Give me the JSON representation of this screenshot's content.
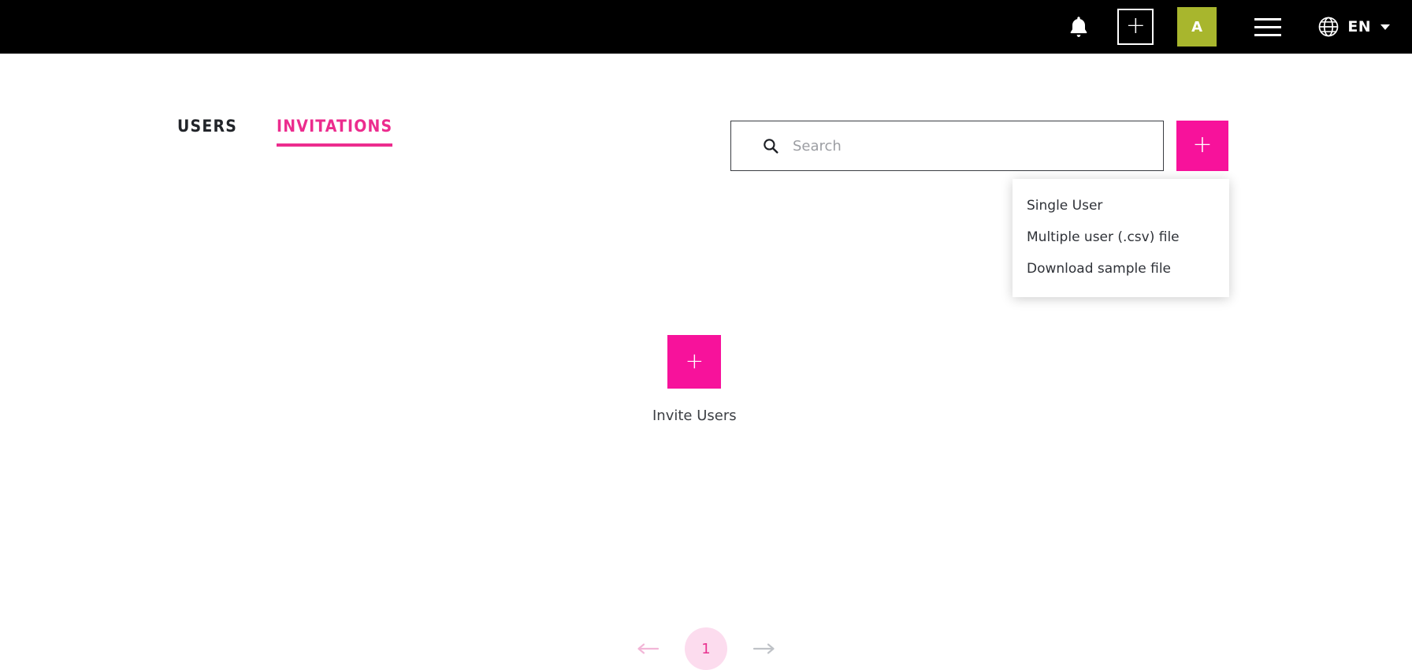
{
  "theme": {
    "topbar_bg": "#000000",
    "accent_pink": "#f7129b",
    "tab_pink": "#ec2c8e",
    "avatar_green": "#a8b62d",
    "page_pill_bg": "#fcdcee",
    "page_pill_text": "#e8328f"
  },
  "topbar": {
    "notifications_icon": "bell-icon",
    "add_icon": "plus-icon",
    "avatar_initial": "A",
    "menu_icon": "hamburger-menu-icon",
    "language_icon": "globe-icon",
    "language_label": "EN",
    "language_caret": "chevron-down-icon"
  },
  "tabs": [
    {
      "id": "users",
      "label": "USERS",
      "active": false
    },
    {
      "id": "invitations",
      "label": "INVITATIONS",
      "active": true
    }
  ],
  "search": {
    "icon": "search-icon",
    "value": "",
    "placeholder": "Search"
  },
  "add_button": {
    "icon": "plus-icon",
    "label": "+"
  },
  "dropdown": {
    "visible": true,
    "items": [
      {
        "label": "Single User"
      },
      {
        "label": "Multiple user (.csv) file"
      },
      {
        "label": "Download sample file"
      }
    ]
  },
  "empty_state": {
    "icon": "plus-icon",
    "label": "Invite Users"
  },
  "pagination": {
    "prev_icon": "arrow-left-icon",
    "next_icon": "arrow-right-icon",
    "current_page": "1"
  }
}
